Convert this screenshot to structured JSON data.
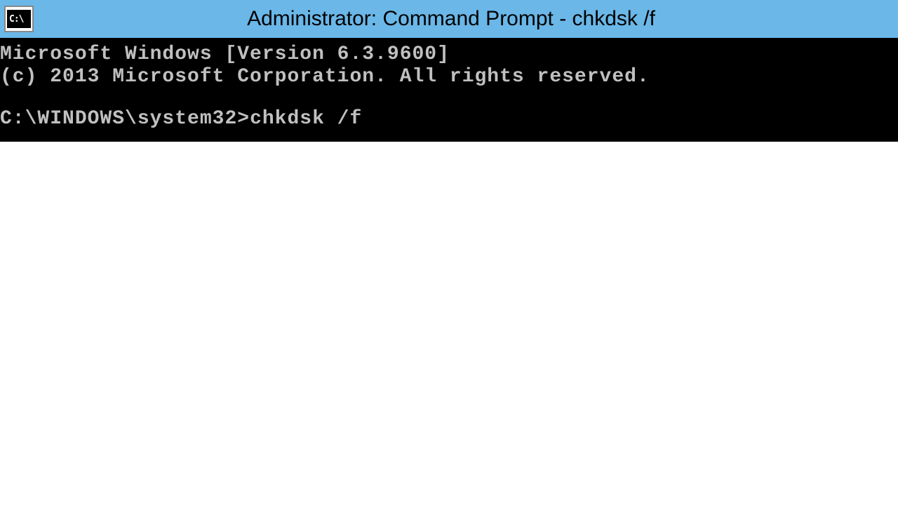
{
  "titlebar": {
    "icon_text": "C:\\",
    "title": "Administrator: Command Prompt - chkdsk  /f"
  },
  "terminal": {
    "version_line": "Microsoft Windows [Version 6.3.9600]",
    "copyright_line": "(c) 2013 Microsoft Corporation. All rights reserved.",
    "prompt": "C:\\WINDOWS\\system32>",
    "command": "chkdsk /f"
  }
}
